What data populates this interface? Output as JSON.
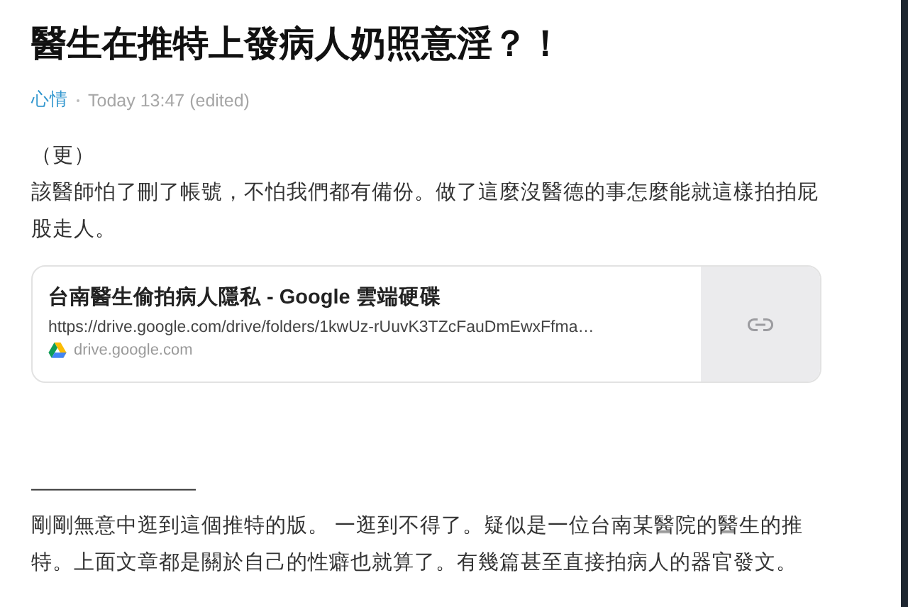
{
  "post": {
    "title": "醫生在推特上發病人奶照意淫？！",
    "forum": "心情",
    "time": "Today 13:47 (edited)"
  },
  "body_top": [
    "（更）",
    "該醫師怕了刪了帳號，不怕我們都有備份。做了這麼沒醫德的事怎麼能就這樣拍拍屁股走人。"
  ],
  "link_card": {
    "title": "台南醫生偷拍病人隱私 - Google 雲端硬碟",
    "url": "https://drive.google.com/drive/folders/1kwUz-rUuvK3TZcFauDmEwxFfma…",
    "domain": "drive.google.com"
  },
  "body_bottom": [
    "————————",
    "剛剛無意中逛到這個推特的版。 一逛到不得了。疑似是一位台南某醫院的醫生的推特。上面文章都是關於自己的性癖也就算了。有幾篇甚至直接拍病人的器官發文。"
  ]
}
